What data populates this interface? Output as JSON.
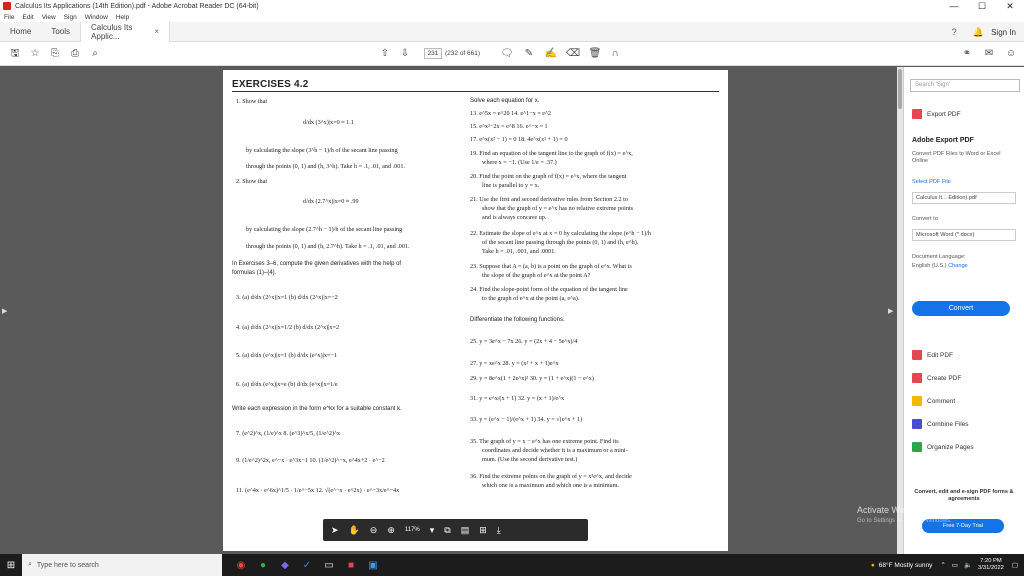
{
  "window": {
    "title": "Calculus Its Applications (14th Edition).pdf - Adobe Acrobat Reader DC (64-bit)",
    "minimize": "—",
    "maximize": "☐",
    "close": "✕"
  },
  "menu": [
    "File",
    "Edit",
    "View",
    "Sign",
    "Window",
    "Help"
  ],
  "tabs": {
    "home": "Home",
    "tools": "Tools",
    "doc": "Calculus Its Applic...",
    "close": "×"
  },
  "header": {
    "help_icon": "?",
    "bell_icon": "🔔",
    "signin": "Sign In"
  },
  "toolbar": {
    "page_current": "231",
    "page_total": "(232 of 661)"
  },
  "document": {
    "heading": "EXERCISES 4.2",
    "left_col": [
      "1. Show that",
      "d/dx (3^x)|x=0 ≈ 1.1",
      "by calculating the slope (3^h − 1)/h of the secant line passing",
      "through the points (0, 1) and (h, 3^h). Take h = .1, .01, and .001.",
      "2. Show that",
      "d/dx (2.7^x)|x=0 ≈ .99",
      "by calculating the slope (2.7^h − 1)/h of the secant line passing",
      "through the points (0, 1) and (h, 2.7^h). Take h = .1, .01, and .001.",
      "In Exercises 3–6, compute the given derivatives with the help of",
      "formulas (1)–(4).",
      "3. (a) d/dx (2^x)|x=1        (b) d/dx (2^x)|x=−2",
      "4. (a) d/dx (2^x)|x=1/2      (b) d/dx (2^x)|x=2",
      "5. (a) d/dx (e^x)|x=1        (b) d/dx (e^x)|x=−1",
      "6. (a) d/dx (e^x)|x=e        (b) d/dx (e^x)|x=1/e",
      "Write each expression in the form e^kx for a suitable constant k.",
      "7. (e^2)^x, (1/e)^x           8. (e^3)^x/5, (1/e^2)^x",
      "9. (1/e^2)^2x, e^−x · e^3x−1   10. (1/e^2)^−x, e^4x+2 · e^−2",
      "11. (e^4x · e^6x)^1/5 · 1/e^−5x    12. √(e^−x · e^2x) · e^−3x/e^−4x"
    ],
    "right_col": [
      "Solve each equation for x.",
      "13. e^5x = e^20              14. e^1−x = e^2",
      "15. e^x²−2x = e^8            16. e^−x = 1",
      "17. e^x(x² − 1) = 0           18. 4e^x(x² + 1) = 0",
      "19. Find an equation of the tangent line to the graph of f(x) = e^x,",
      "where x = −1. (Use 1/e = .37.)",
      "20. Find the point on the graph of f(x) = e^x, where the tangent",
      "line is parallel to y = x.",
      "21. Use the first and second derivative rules from Section 2.2 to",
      "show that the graph of y = e^x has no relative extreme points",
      "and is always concave up.",
      "22. Estimate the slope of e^x at x = 0 by calculating the slope (e^h − 1)/h",
      "of the secant line passing through the points (0, 1) and (h, e^h).",
      "Take h = .01, .001, and .0001.",
      "23. Suppose that A = (a, b) is a point on the graph of e^x. What is",
      "the slope of the graph of e^x at the point A?",
      "24. Find the slope-point form of the equation of the tangent line",
      "to the graph of e^x at the point (a, e^a).",
      "Differentiate the following functions.",
      "25. y = 3e^x − 7x             26. y = (2x + 4 − 5e^x)/4",
      "27. y = xe^x                  28. y = (x² + x + 1)e^x",
      "29. y = 8e^x(1 + 2e^x)²        30. y = (1 + e^x)(1 − e^x)",
      "31. y = e^x/(x + 1)           32. y = (x + 1)/e^x",
      "33. y = (e^x − 1)/(e^x + 1)    34. y = √(e^x + 1)",
      "35. The graph of y = x − e^x has one extreme point. Find its",
      "coordinates and decide whether it is a maximum or a mini-",
      "mum. (Use the second derivative test.)",
      "36. Find the extreme points on the graph of y = x²e^x, and decide",
      "which one is a maximum and which one is a minimum."
    ]
  },
  "bottom_toolbar": {
    "zoom": "117%"
  },
  "right_panel": {
    "search_placeholder": "Search 'Sign'",
    "export_pdf": "Export PDF",
    "export_title": "Adobe Export PDF",
    "export_desc": "Convert PDF Files to Word or Excel Online",
    "select_label": "Select PDF File",
    "selected_file": "Calculus It... Edition).pdf",
    "convert_to": "Convert to",
    "format": "Microsoft Word (*.docx)",
    "doc_lang_label": "Document Language:",
    "doc_lang": "English (U.S.)",
    "change": "Change",
    "convert_btn": "Convert",
    "items": [
      "Edit PDF",
      "Create PDF",
      "Comment",
      "Combine Files",
      "Organize Pages"
    ],
    "footer": "Convert, edit and e-sign PDF forms & agreements",
    "trial": "Free 7-Day Trial",
    "watermark": "Activate Windows",
    "watermark_sub": "Go to Settings to activate Windows."
  },
  "taskbar": {
    "search": "Type here to search",
    "weather": "68°F  Mostly sunny",
    "time": "7:20 PM",
    "date": "3/31/2022"
  },
  "colors": {
    "accent": "#1473e6",
    "acrobat_red": "#d9241c"
  }
}
